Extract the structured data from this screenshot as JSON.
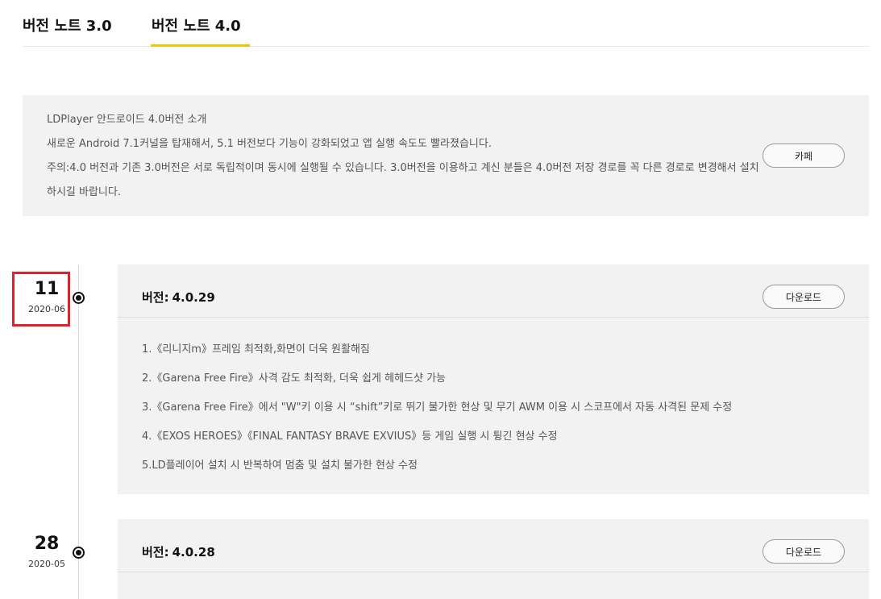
{
  "tabs": [
    {
      "label": "버전 노트 3.0"
    },
    {
      "label": "버전 노트 4.0",
      "active": true
    }
  ],
  "accent_color": "#f5c400",
  "highlight_color": "#e0202a",
  "intro": {
    "lines": [
      "LDPlayer 안드로이드 4.0버전 소개",
      "새로운 Android 7.1커널을 탑재해서, 5.1 버전보다 기능이 강화되었고 앱 실행 속도도 빨라졌습니다.",
      "주의:4.0 버전과 기존 3.0버전은 서로 독립적이며 동시에 실행될 수 있습니다. 3.0버전을 이용하고 계신 분들은 4.0버전 저장 경로를 꼭 다른 경로로 변경해서 설치하시길 바랍니다."
    ],
    "cafe_button": "카페"
  },
  "releases": [
    {
      "day": "11",
      "year_month": "2020-06",
      "version_label": "버전:",
      "version": "4.0.29",
      "download_label": "다운로드",
      "notes": [
        "1.《리니지m》프레임 최적화,화면이 더욱 원활해짐",
        "2.《Garena Free Fire》사격 감도 최적화, 더욱 쉽게 헤헤드샷 가능",
        "3.《Garena Free Fire》에서 \"W\"키 이용 시 “shift”키로 뛰기 불가한 현상 및 무기 AWM 이용 시 스코프에서 자동 사격된 문제 수정",
        "4.《EXOS HEROES》《FINAL FANTASY BRAVE EXVIUS》등 게임 실행 시 튕긴 현상 수정",
        "5.LD플레이어 설치 시 반복하여 멈춤 및 설치 불가한 현상 수정"
      ]
    },
    {
      "day": "28",
      "year_month": "2020-05",
      "version_label": "버전:",
      "version": "4.0.28",
      "download_label": "다운로드",
      "notes": []
    }
  ]
}
